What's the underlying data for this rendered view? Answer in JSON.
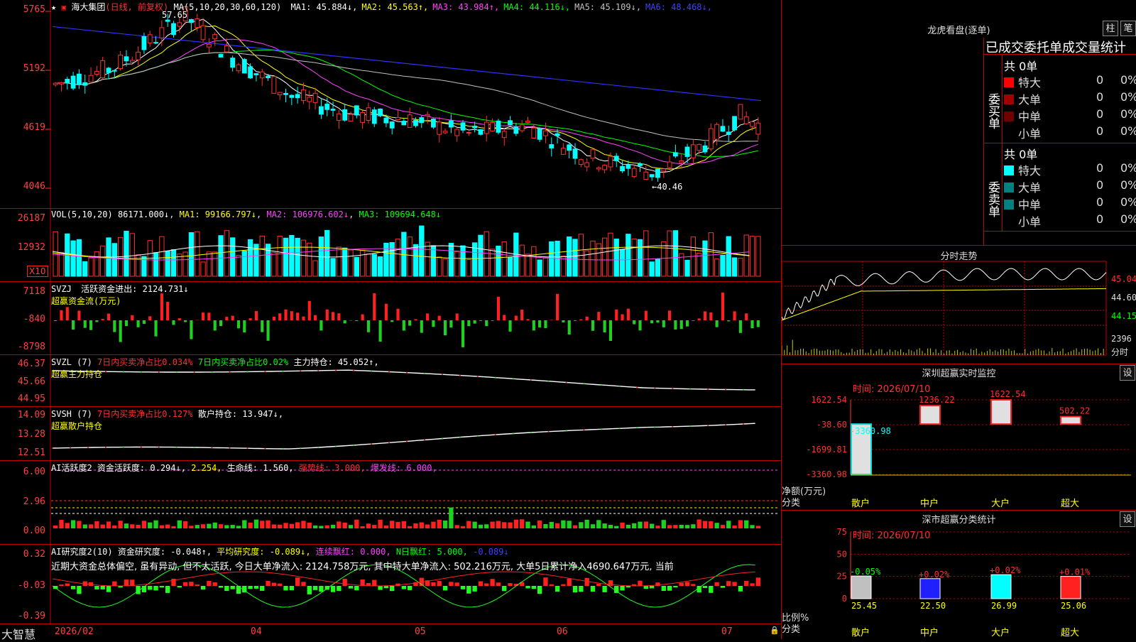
{
  "stock": {
    "name": "海大集团",
    "mode": "(日线, 前复权)",
    "star": "★",
    "max_label": "57.65",
    "min_label": "←40.46"
  },
  "ma": {
    "label": "MA(5,10,20,30,60,120)",
    "items": [
      {
        "text": "MA1: 45.884↓",
        "color": "#ffffff"
      },
      {
        "text": "MA2: 45.563↑",
        "color": "#ffff00"
      },
      {
        "text": "MA3: 43.984↑",
        "color": "#ff40ff"
      },
      {
        "text": "MA4: 44.116↓",
        "color": "#00ff00"
      },
      {
        "text": "MA5: 45.109↓",
        "color": "#c0c0c0"
      },
      {
        "text": "MA6: 48.468↓",
        "color": "#4040ff"
      }
    ]
  },
  "price_ticks": [
    "5765",
    "5192",
    "4619",
    "4046"
  ],
  "vol": {
    "label": "VOL(5,10,20)",
    "value": "86171.000↓",
    "ma1": "MA1: 99166.797↓",
    "ma2": "MA2: 106976.602↓",
    "ma3": "MA3: 109694.648↓",
    "ticks": [
      "26187",
      "12932"
    ],
    "unit": "X10"
  },
  "svzj": {
    "label": "SVZJ",
    "title": "活跃资金进出: 2124.731↓",
    "sub": "超赢资金流(万元)",
    "ticks": [
      "7118",
      "-840",
      "-8798"
    ]
  },
  "svzl": {
    "label": "SVZL (7)",
    "p1": "7日内买卖净占比0.034%",
    "p2": "7日内买卖净占比0.02%",
    "p3": "主力持仓: 45.052↑,",
    "sub": "超赢主力持仓",
    "ticks": [
      "46.37",
      "45.66",
      "44.95"
    ]
  },
  "svsh": {
    "label": "SVSH (7)",
    "p1": "7日内买卖净占比0.127%",
    "p2": "散户持仓: 13.947↓,",
    "sub": "超赢散户持仓",
    "ticks": [
      "14.09",
      "13.28",
      "12.51"
    ]
  },
  "ai1": {
    "label": "AI活跃度2",
    "t1": "资金活跃度: 0.294↓,",
    "t2": "2.254,",
    "t3": "生命线: 1.560,",
    "t4": "强势线: 3.000,",
    "t5": "爆发线: 6.000,",
    "ticks": [
      "6.00",
      "2.96",
      "0.00"
    ]
  },
  "ai2": {
    "label": "AI研究度2(10)",
    "t1": "资金研究度: -0.048↑,",
    "t2": "平均研究度: -0.089↓,",
    "t3": "连续飘红: 0.000,",
    "t4": "N日飘红: 5.000,",
    "t5": "-0.089↓",
    "note": "近期大资金总体偏空, 虽有异动, 但不太活跃, 今日大单净流入: 2124.758万元, 其中特大单净流入: 502.216万元, 大单5日累计净入4690.647万元, 当前",
    "ticks": [
      "0.32",
      "-0.03",
      "-0.39"
    ]
  },
  "xaxis": {
    "brand": "大智慧",
    "labels": [
      "2026/02",
      "04",
      "05",
      "06",
      "07"
    ]
  },
  "dragon": {
    "title": "龙虎看盘(逐单)",
    "btn_zhu": "柱",
    "btn_bi": "笔",
    "tabs": "已成交委托单成交量统计",
    "buy": {
      "label": "委买单",
      "total": "共 0单",
      "rows": [
        {
          "name": "特大",
          "v": "0",
          "p": "0%",
          "color": "#ff0000"
        },
        {
          "name": "大单",
          "v": "0",
          "p": "0%",
          "color": "#a00000"
        },
        {
          "name": "中单",
          "v": "0",
          "p": "0%",
          "color": "#700000"
        },
        {
          "name": "小单",
          "v": "0",
          "p": "0%",
          "color": "#000000"
        }
      ]
    },
    "sell": {
      "label": "委卖单",
      "total": "共 0单",
      "rows": [
        {
          "name": "特大",
          "v": "0",
          "p": "0%",
          "color": "#00ffff"
        },
        {
          "name": "大单",
          "v": "0",
          "p": "0%",
          "color": "#008080"
        },
        {
          "name": "中单",
          "v": "0",
          "p": "0%",
          "color": "#008080"
        },
        {
          "name": "小单",
          "v": "0",
          "p": "0%",
          "color": "#000000"
        }
      ]
    }
  },
  "intraday": {
    "title": "分时走势",
    "ticks": [
      "45.04",
      "44.60",
      "44.15"
    ],
    "vol_tick": "2396",
    "vol_label": "分时"
  },
  "sz": {
    "title": "深圳超赢实时监控",
    "btn": "设",
    "time": "时间: 2026/07/10",
    "ylabel": "净额(万元)",
    "xlabel": "分类",
    "ticks": [
      "1622.54",
      "-38.60",
      "-1699.81",
      "-3360.98"
    ],
    "bars": [
      {
        "cat": "散户",
        "value": -3360.98,
        "label": "-3360.98"
      },
      {
        "cat": "中户",
        "value": 1236.22,
        "label": "1236.22"
      },
      {
        "cat": "大户",
        "value": 1622.54,
        "label": "1622.54"
      },
      {
        "cat": "超大",
        "value": 502.22,
        "label": "502.22"
      }
    ]
  },
  "ss": {
    "title": "深市超赢分类统计",
    "btn": "设",
    "time": "时间: 2026/07/10",
    "ylabel": "比例%",
    "xlabel": "分类",
    "ticks": [
      "75",
      "50",
      "25",
      "0"
    ],
    "bars": [
      {
        "cat": "散户",
        "value": 25.45,
        "chg": "-0.05%",
        "color": "#c0c0c0"
      },
      {
        "cat": "中户",
        "value": 22.5,
        "chg": "+0.02%",
        "color": "#2020ff"
      },
      {
        "cat": "大户",
        "value": 26.99,
        "chg": "+0.02%",
        "color": "#00ffff"
      },
      {
        "cat": "超大",
        "value": 25.06,
        "chg": "+0.01%",
        "color": "#ff2020"
      }
    ]
  },
  "chart_data": {
    "type": "bar",
    "categories": [
      "散户",
      "中户",
      "大户",
      "超大"
    ],
    "values": [
      -3360.98,
      1236.22,
      1622.54,
      502.22
    ],
    "title": "深圳超赢实时监控",
    "xlabel": "分类",
    "ylabel": "净额(万元)"
  }
}
